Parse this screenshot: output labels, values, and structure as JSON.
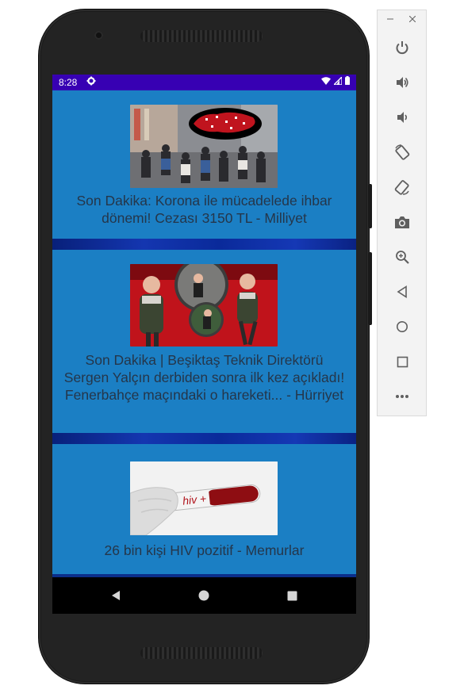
{
  "status_bar": {
    "time": "8:28"
  },
  "feed": [
    {
      "title": "Son Dakika: Korona ile mücadelede ihbar dönemi! Cezası 3150 TL - Milliyet"
    },
    {
      "title": "Son Dakika | Beşiktaş Teknik Direktörü Sergen Yalçın derbiden sonra ilk kez açıkladı! Fenerbahçe maçındaki o hareketi... - Hürriyet"
    },
    {
      "title": "26 bin kişi HIV pozitif - Memurlar",
      "image_text": "hiv +"
    }
  ],
  "emulator_toolbar": {
    "buttons": [
      "power-icon",
      "volume-up-icon",
      "volume-down-icon",
      "rotate-left-icon",
      "rotate-right-icon",
      "camera-icon",
      "zoom-icon",
      "back-icon",
      "home-icon",
      "overview-icon",
      "more-icon"
    ]
  },
  "colors": {
    "status_bar": "#3700b3",
    "card_background": "#1b7fc4",
    "title_text": "#25364a",
    "separator": "#0b2e8a"
  }
}
